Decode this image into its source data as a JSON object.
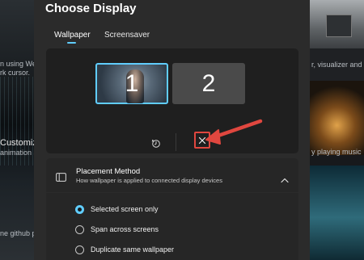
{
  "background_app": {
    "left_texts": [
      "n using Web",
      "rk cursor.",
      "Customizati",
      "animation s",
      "ne github pa"
    ],
    "right_texts": [
      "r, visualizer and",
      "y playing music"
    ]
  },
  "dialog": {
    "title": "Choose Display",
    "tabs": [
      {
        "label": "Wallpaper",
        "selected": true
      },
      {
        "label": "Screensaver",
        "selected": false
      }
    ]
  },
  "displays": [
    {
      "label": "1",
      "selected": true
    },
    {
      "label": "2",
      "selected": false
    }
  ],
  "icons": {
    "identify": "identify-icon",
    "close": "close-icon",
    "placement": "monitor-icon",
    "chevron": "chevron-up-icon"
  },
  "placement": {
    "title": "Placement Method",
    "subtitle": "How wallpaper is applied to connected display devices",
    "options": [
      {
        "label": "Selected screen only",
        "checked": true
      },
      {
        "label": "Span across screens",
        "checked": false
      },
      {
        "label": "Duplicate same wallpaper",
        "checked": false
      }
    ]
  },
  "colors": {
    "accent": "#60cdff",
    "highlight": "#e0473f",
    "dialog_bg": "#2b2b2b",
    "panel_bg": "#1f1f1f"
  }
}
